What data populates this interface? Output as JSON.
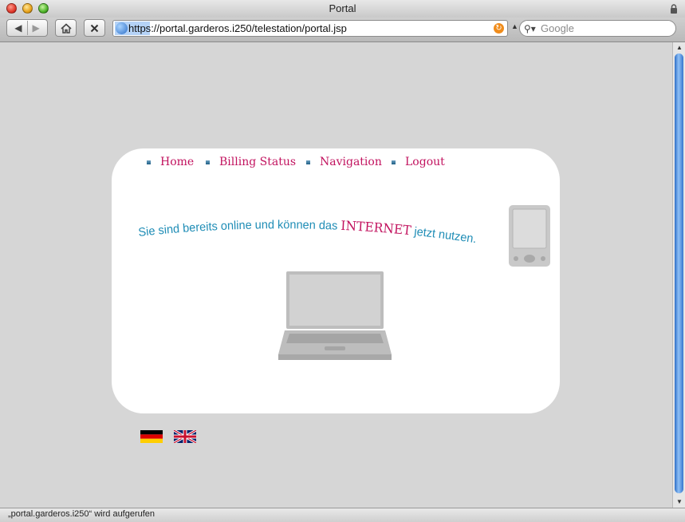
{
  "window": {
    "title": "Portal"
  },
  "toolbar": {
    "url_scheme": "https",
    "url_rest": "://portal.garderos.i250/telestation/portal.jsp",
    "search_placeholder": "Google"
  },
  "nav": {
    "items": [
      {
        "label": "Home"
      },
      {
        "label": "Billing Status"
      },
      {
        "label": "Navigation"
      },
      {
        "label": "Logout"
      }
    ]
  },
  "tagline": {
    "before": "Sie sind bereits online und können das ",
    "highlight": "INTERNET",
    "after": " jetzt nutzen."
  },
  "languages": [
    "de-flag-icon",
    "uk-flag-icon"
  ],
  "status": {
    "text": "„portal.garderos.i250“ wird aufgerufen"
  },
  "colors": {
    "accent": "#c2135f",
    "tagline": "#1f8db6",
    "background": "#d6d6d6",
    "card": "#ffffff"
  }
}
